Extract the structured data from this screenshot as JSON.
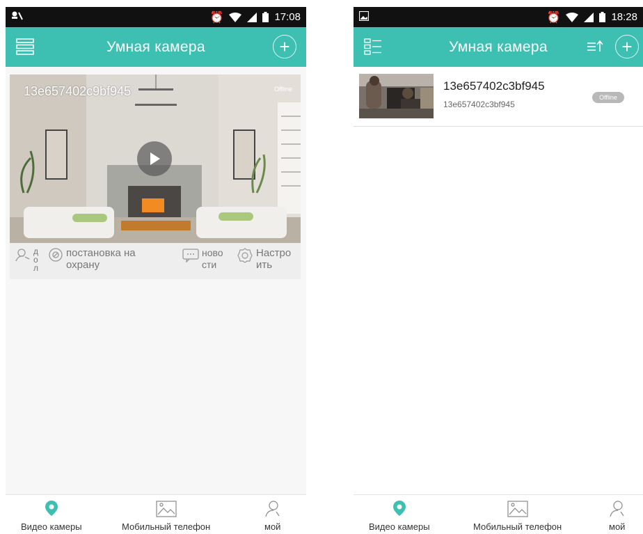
{
  "left": {
    "status": {
      "time": "17:08"
    },
    "app_title": "Умная камера",
    "add_label": "+",
    "camera": {
      "name": "13e657402c9bf945",
      "status": "Offline"
    },
    "actions": {
      "playback": "д\nо\nл",
      "arm": "постановка на\nохрану",
      "news": "ново\nсти",
      "settings": "Настро\nить"
    },
    "nav": {
      "video": "Видео камеры",
      "mobile": "Мобильный телефон",
      "mine": "мой"
    }
  },
  "right": {
    "status": {
      "time": "18:28"
    },
    "app_title": "Умная камера",
    "add_label": "+",
    "item": {
      "name": "13e657402c3bf945",
      "sub": "13e657402c3bf945",
      "status": "Offline"
    },
    "nav": {
      "video": "Видео камеры",
      "mobile": "Мобильный телефон",
      "mine": "мой"
    }
  },
  "colors": {
    "accent": "#3dbfb1",
    "statusbar": "#111111"
  },
  "icons": [
    "menu-icon",
    "add-icon",
    "sort-icon",
    "play-icon",
    "playback-user-icon",
    "shield-icon",
    "message-icon",
    "gear-icon",
    "location-pin-icon",
    "image-icon",
    "person-icon",
    "alarm-icon",
    "wifi-icon",
    "signal-icon",
    "battery-icon"
  ]
}
